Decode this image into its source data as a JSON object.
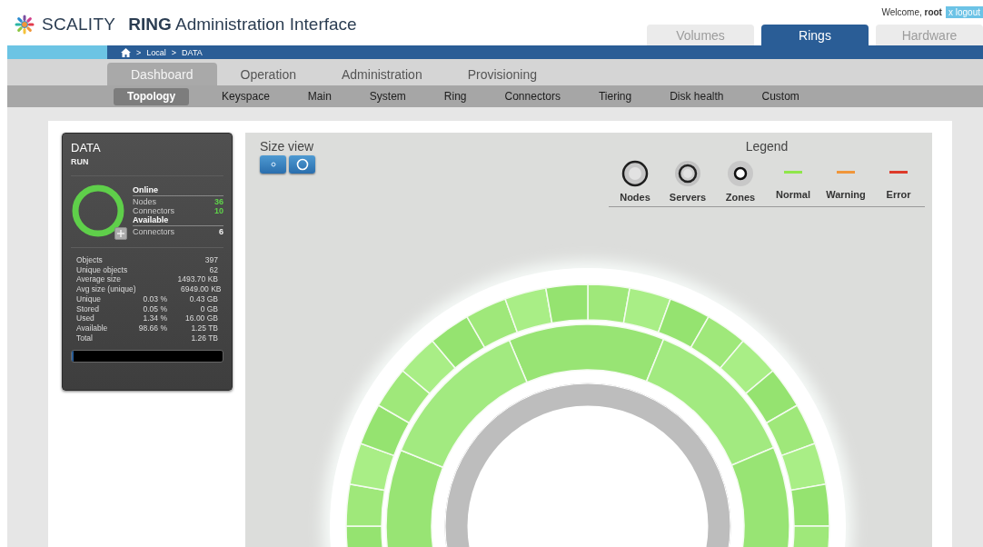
{
  "header": {
    "brand": "SCALITY",
    "title": "**RING** Administration Interface",
    "welcome": "Welcome, **root**",
    "logout": "x logout",
    "tabs": [
      {
        "label": "Volumes",
        "selected": false
      },
      {
        "label": "Rings",
        "selected": true
      },
      {
        "label": "Hardware",
        "selected": false
      }
    ]
  },
  "breadcrumb": [
    ">",
    "Local",
    ">",
    "DATA"
  ],
  "main_nav": [
    {
      "label": "Dashboard",
      "selected": true
    },
    {
      "label": "Operation",
      "selected": false
    },
    {
      "label": "Administration",
      "selected": false
    },
    {
      "label": "Provisioning",
      "selected": false
    }
  ],
  "sub_nav": [
    {
      "label": "Topology",
      "selected": true
    },
    {
      "label": "Keyspace",
      "selected": false
    },
    {
      "label": "Main",
      "selected": false
    },
    {
      "label": "System",
      "selected": false
    },
    {
      "label": "Ring",
      "selected": false
    },
    {
      "label": "Connectors",
      "selected": false
    },
    {
      "label": "Tiering",
      "selected": false
    },
    {
      "label": "Disk health",
      "selected": false
    },
    {
      "label": "Custom",
      "selected": false
    }
  ],
  "ring_card": {
    "name": "DATA",
    "status": "RUN",
    "sections": [
      {
        "heading": "Online",
        "rows": [
          {
            "label": "Nodes",
            "value": "36",
            "highlight": true
          },
          {
            "label": "Connectors",
            "value": "10",
            "highlight": true
          }
        ]
      },
      {
        "heading": "Available",
        "rows": [
          {
            "label": "Connectors",
            "value": "6",
            "highlight": false
          }
        ]
      }
    ],
    "stats": [
      {
        "label": "Objects",
        "value": "397"
      },
      {
        "label": "Unique objects",
        "value": "62"
      },
      {
        "label": "Average size",
        "value": "1493.70 KB"
      },
      {
        "label": "Avg size (unique)",
        "value": "6949.00 KB"
      },
      {
        "label": "Unique",
        "percent": "0.03 %",
        "value": "0.43 GB"
      },
      {
        "label": "Stored",
        "percent": "0.05 %",
        "value": "0 GB"
      },
      {
        "label": "Used",
        "percent": "1.34 %",
        "value": "16.00 GB"
      },
      {
        "label": "Available",
        "percent": "98.66 %",
        "value": "1.25 TB"
      },
      {
        "label": "Total",
        "value": "1.26 TB"
      }
    ],
    "usage": {
      "level": 0.01
    }
  },
  "size_view": {
    "title": "Size view"
  },
  "legend": {
    "title": "Legend",
    "items": [
      {
        "label": "Nodes",
        "kind": "outer"
      },
      {
        "label": "Servers",
        "kind": "middle"
      },
      {
        "label": "Zones",
        "kind": "inner"
      },
      {
        "label": "Normal",
        "kind": "line",
        "color": "#8fe64a"
      },
      {
        "label": "Warning",
        "kind": "line",
        "color": "#f0963a"
      },
      {
        "label": "Error",
        "kind": "line",
        "color": "#dd3a2a"
      }
    ]
  }
}
